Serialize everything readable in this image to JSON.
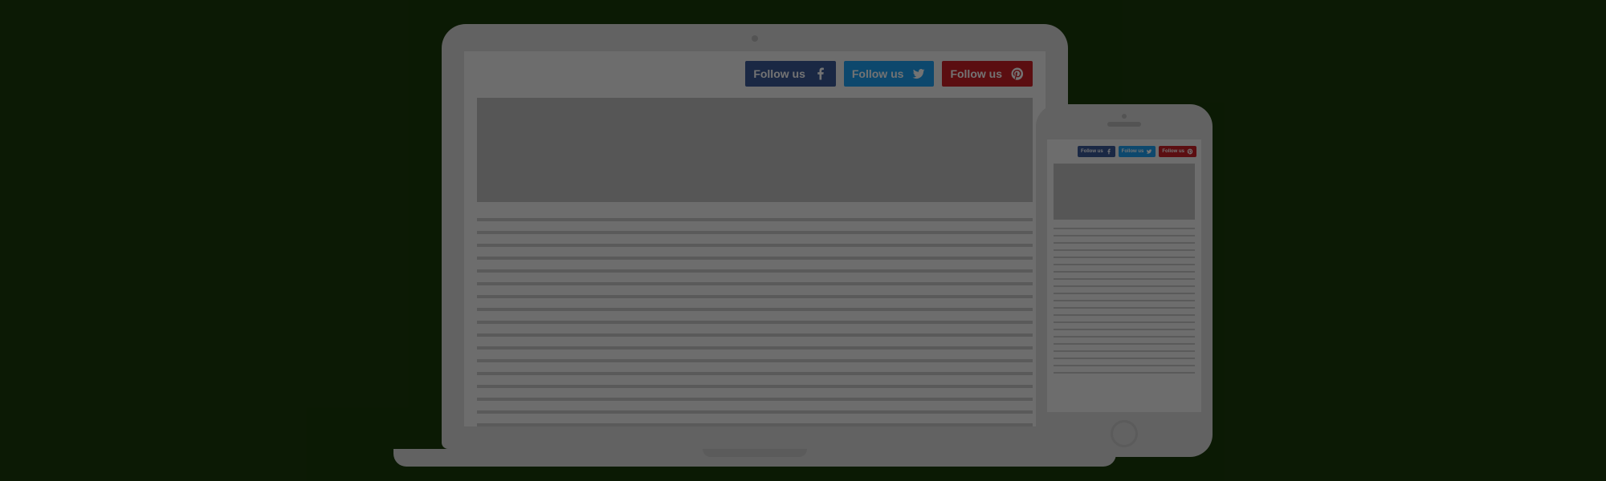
{
  "social": {
    "facebook": {
      "label": "Follow us",
      "icon": "facebook-icon",
      "color": "#3b5998"
    },
    "twitter": {
      "label": "Follow us",
      "icon": "twitter-icon",
      "color": "#1da1f2"
    },
    "pinterest": {
      "label": "Follow us",
      "icon": "pinterest-icon",
      "color": "#cb2027"
    }
  }
}
